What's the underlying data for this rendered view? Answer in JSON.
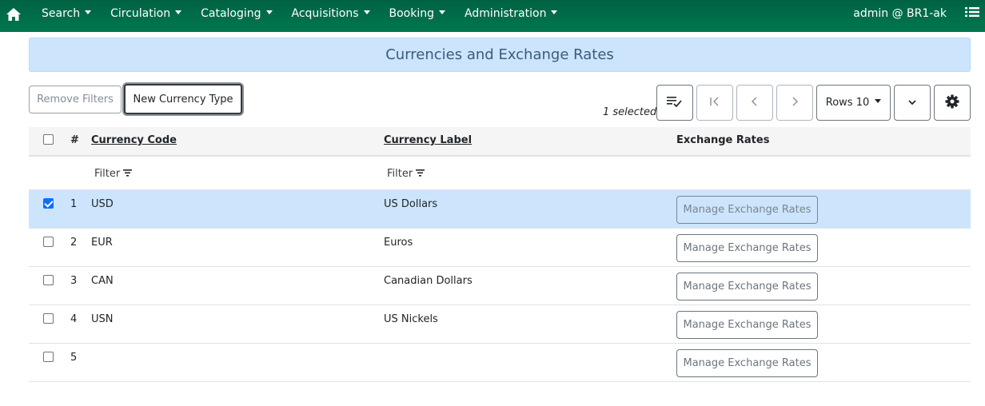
{
  "navbar": {
    "home_icon": "home-icon",
    "menus": [
      {
        "label": "Search"
      },
      {
        "label": "Circulation"
      },
      {
        "label": "Cataloging"
      },
      {
        "label": "Acquisitions"
      },
      {
        "label": "Booking"
      },
      {
        "label": "Administration"
      }
    ],
    "user": "admin @ BR1-ak",
    "menu_icon": "list-icon"
  },
  "page": {
    "title": "Currencies and Exchange Rates"
  },
  "toolbar": {
    "remove_filters": "Remove Filters",
    "new_currency_type": "New Currency Type",
    "selected_count": "1 selected",
    "rows_label": "Rows 10",
    "icons": {
      "select_all": "list-check-icon",
      "first_page": "first-page-icon",
      "prev_page": "chevron-left-icon",
      "next_page": "chevron-right-icon",
      "expand": "chevron-down-icon",
      "settings": "gear-icon"
    }
  },
  "grid": {
    "columns": {
      "num": "#",
      "code": "Currency Code",
      "label": "Currency Label",
      "rates": "Exchange Rates"
    },
    "filter_label": "Filter",
    "rows": [
      {
        "num": "1",
        "code": "USD",
        "label": "US Dollars",
        "action": "Manage Exchange Rates",
        "selected": true
      },
      {
        "num": "2",
        "code": "EUR",
        "label": "Euros",
        "action": "Manage Exchange Rates",
        "selected": false
      },
      {
        "num": "3",
        "code": "CAN",
        "label": "Canadian Dollars",
        "action": "Manage Exchange Rates",
        "selected": false
      },
      {
        "num": "4",
        "code": "USN",
        "label": "US Nickels",
        "action": "Manage Exchange Rates",
        "selected": false
      },
      {
        "num": "5",
        "code": "",
        "label": "",
        "action": "Manage Exchange Rates",
        "selected": false
      }
    ]
  }
}
